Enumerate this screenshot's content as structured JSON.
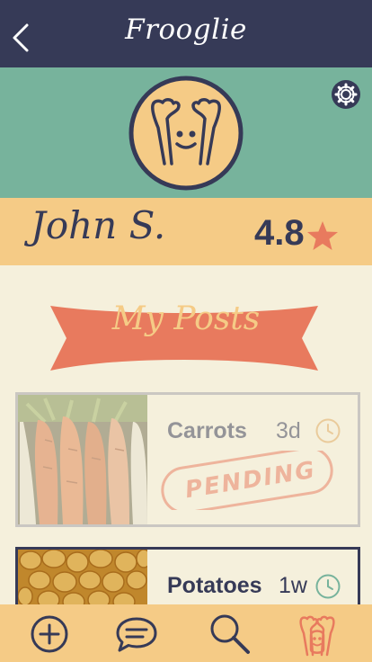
{
  "app": {
    "title": "Frooglie"
  },
  "colors": {
    "navy": "#363a57",
    "teal": "#77b39c",
    "sand": "#f5cb86",
    "coral": "#e87a5e",
    "cream": "#f5f0dc",
    "green": "#77b39c"
  },
  "header": {
    "back_icon": "chevron-left-icon"
  },
  "profile": {
    "settings_icon": "gear-icon",
    "avatar_icon": "froggy-face-icon",
    "name": "John S.",
    "rating": "4.8",
    "rating_icon": "star-icon"
  },
  "section": {
    "title": "My Posts"
  },
  "posts": [
    {
      "title": "Carrots",
      "age": "3d",
      "status": "PENDING",
      "image": "carrots-photo",
      "time_icon": "clock-icon"
    },
    {
      "title": "Potatoes",
      "age": "1w",
      "image": "potatoes-photo",
      "time_icon": "clock-icon"
    }
  ],
  "tabbar": {
    "items": [
      {
        "name": "add",
        "icon": "plus-circle-icon"
      },
      {
        "name": "messages",
        "icon": "chat-bubbles-icon"
      },
      {
        "name": "search",
        "icon": "search-icon"
      },
      {
        "name": "profile",
        "icon": "froggy-face-icon",
        "active": true
      }
    ]
  }
}
